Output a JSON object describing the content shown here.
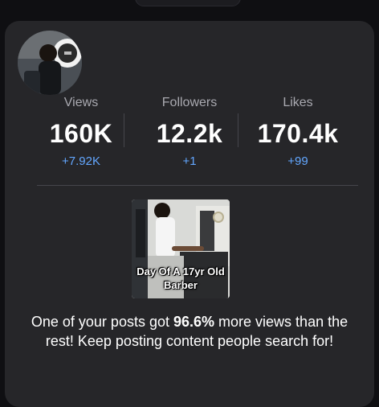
{
  "stats": [
    {
      "label": "Views",
      "value": "160K",
      "delta": "+7.92K"
    },
    {
      "label": "Followers",
      "value": "12.2k",
      "delta": "+1"
    },
    {
      "label": "Likes",
      "value": "170.4k",
      "delta": "+99"
    }
  ],
  "post": {
    "caption_line1": "Day Of A 17yr Old",
    "caption_line2": "Barber"
  },
  "message": {
    "before": "One of your posts got ",
    "highlight": "96.6%",
    "after": " more views than the rest! Keep posting content people search for!"
  },
  "colors": {
    "background": "#0f0f12",
    "card": "#262629",
    "delta": "#63a7ff"
  }
}
